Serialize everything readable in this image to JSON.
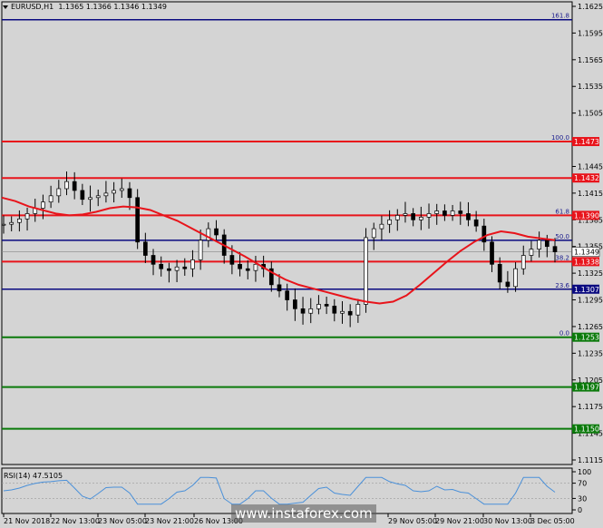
{
  "header": {
    "symbol": "EURUSD,H1",
    "ohlc": "1.1365 1.1366 1.1346 1.1349"
  },
  "colors": {
    "background": "#d4d4d4",
    "red": "#e8141b",
    "navy": "#0a0a80",
    "green": "#0b7a0b",
    "candle": "#000000",
    "rsi": "#4a90d9"
  },
  "price_axis": {
    "ticks": [
      "1.1625",
      "1.1595",
      "1.1565",
      "1.1535",
      "1.1505",
      "1.1445",
      "1.1415",
      "1.1385",
      "1.1355",
      "1.1325",
      "1.1295",
      "1.1265",
      "1.1235",
      "1.1205",
      "1.1175",
      "1.1145",
      "1.1115"
    ]
  },
  "levels": [
    {
      "price": 1.161,
      "color": "navy",
      "fib": "161.8",
      "tag": ""
    },
    {
      "price": 1.1473,
      "color": "red",
      "fib": "100.0",
      "tag": "1.1473"
    },
    {
      "price": 1.1432,
      "color": "red",
      "fib": "",
      "tag": "1.1432"
    },
    {
      "price": 1.139,
      "color": "red",
      "fib": "61.8",
      "tag": "1.1390"
    },
    {
      "price": 1.1362,
      "color": "navy",
      "fib": "50.0",
      "tag": ""
    },
    {
      "price": 1.1338,
      "color": "red",
      "fib": "38.2",
      "tag": "1.1338"
    },
    {
      "price": 1.1307,
      "color": "navy",
      "fib": "23.6",
      "tag": "1.1307"
    },
    {
      "price": 1.1253,
      "color": "green",
      "fib": "0.0",
      "tag": "1.1253"
    },
    {
      "price": 1.1197,
      "color": "green",
      "fib": "",
      "tag": "1.1197"
    },
    {
      "price": 1.115,
      "color": "green",
      "fib": "",
      "tag": "1.1150"
    }
  ],
  "current_price_tag": "1.1349",
  "time_axis": [
    "21 Nov 2018",
    "22 Nov 13:00",
    "23 Nov 05:00",
    "23 Nov 21:00",
    "26 Nov 13:00",
    "29 Nov 05:00",
    "29 Nov 21:00",
    "30 Nov 13:00",
    "3 Dec 05:00"
  ],
  "rsi": {
    "label": "RSI(14) 47.5105",
    "ticks": [
      "100",
      "70",
      "30",
      "0"
    ]
  },
  "watermark": "www.instaforex.com",
  "chart_data": {
    "type": "line",
    "series": [
      {
        "values": [
          1.138,
          1.1382,
          1.1386,
          1.1392,
          1.1398,
          1.1405,
          1.1412,
          1.142,
          1.1428,
          1.1418,
          1.1408,
          1.141,
          1.1412,
          1.1415,
          1.1418,
          1.142,
          1.141,
          1.136,
          1.1345,
          1.1335,
          1.133,
          1.1328,
          1.1332,
          1.133,
          1.134,
          1.1362,
          1.1375,
          1.1368,
          1.1345,
          1.1335,
          1.133,
          1.1328,
          1.1335,
          1.133,
          1.1312,
          1.1305,
          1.1295,
          1.1285,
          1.128,
          1.1285,
          1.129,
          1.1288,
          1.128,
          1.1282,
          1.1278,
          1.129,
          1.1365,
          1.1375,
          1.138,
          1.1385,
          1.139,
          1.1392,
          1.1385,
          1.1388,
          1.1392,
          1.1395,
          1.139,
          1.1395,
          1.1392,
          1.1385,
          1.1378,
          1.136,
          1.1335,
          1.1315,
          1.131,
          1.133,
          1.1345,
          1.1352,
          1.1362,
          1.1355,
          1.1349
        ]
      },
      {
        "values": [
          1.141,
          1.1406,
          1.14,
          1.1396,
          1.1392,
          1.139,
          1.1391,
          1.1394,
          1.1398,
          1.14,
          1.1399,
          1.1396,
          1.139,
          1.1384,
          1.1376,
          1.1368,
          1.136,
          1.1352,
          1.1344,
          1.1335,
          1.1326,
          1.1318,
          1.1312,
          1.1308,
          1.1304,
          1.13,
          1.1296,
          1.1293,
          1.1291,
          1.1293,
          1.13,
          1.1312,
          1.1325,
          1.1338,
          1.135,
          1.136,
          1.1368,
          1.1372,
          1.137,
          1.1366,
          1.1364,
          1.1362
        ]
      }
    ],
    "ylim": [
      1.11,
      1.164
    ]
  }
}
